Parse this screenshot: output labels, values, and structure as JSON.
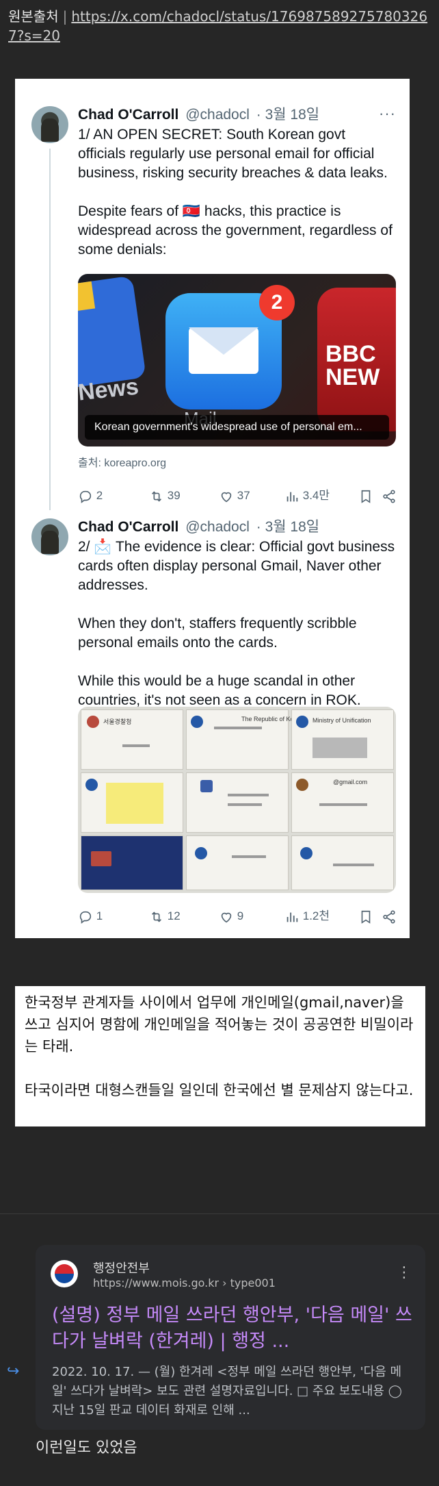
{
  "source": {
    "label": "원본출처",
    "separator": "|",
    "url": "https://x.com/chadocl/status/1769875892757803267?s=20"
  },
  "tweets": [
    {
      "name": "Chad O'Carroll",
      "handle": "@chadocl",
      "date": "· 3월 18일",
      "paragraphs": [
        "1/ AN OPEN SECRET: South Korean govt officials regularly use personal email for official business, risking security breaches & data leaks.",
        "Despite fears of 🇰🇵 hacks, this practice is widespread across the government, regardless of some denials:"
      ],
      "media": {
        "caption": "Korean government's widespread use of personal em...",
        "badge": "2",
        "app_news": "News",
        "app_mail": "Mail",
        "app_bbc": "BBC NEW"
      },
      "source_label": "출처: koreapro.org",
      "stats": {
        "replies": "2",
        "retweets": "39",
        "likes": "37",
        "views": "3.4만"
      }
    },
    {
      "name": "Chad O'Carroll",
      "handle": "@chadocl",
      "date": "· 3월 18일",
      "paragraphs": [
        "2/ 📩 The evidence is clear: Official govt business cards often display personal Gmail, Naver other addresses.",
        "When they don't, staffers frequently scribble personal emails onto the cards.",
        "While this would be a huge scandal in other countries, it's not seen as a concern in ROK."
      ],
      "media": {
        "card_ministry": "Ministry of Unification",
        "card_korea": "The Republic of Korea",
        "card_gmail": "@gmail.com",
        "card_seoul": "서울경찰청"
      },
      "stats": {
        "replies": "1",
        "retweets": "12",
        "likes": "9",
        "views": "1.2천"
      }
    }
  ],
  "korean_note": {
    "p1": "한국정부 관계자들 사이에서 업무에 개인메일(gmail,naver)을 쓰고 심지어 명함에 개인메일을 적어놓는 것이 공공연한 비밀이라는 타래.",
    "p2": "타국이라면 대형스캔들일 일인데 한국에선 별 문제삼지 않는다고."
  },
  "search_result": {
    "site_name": "행정안전부",
    "site_url": "https://www.mois.go.kr › type001",
    "title": "(설명) 정부 메일 쓰라던 행안부, '다음 메일' 쓰다가 날벼락 (한겨레) | 행정 ...",
    "snippet": "2022. 10. 17. — (월) 한겨레 <정부 메일 쓰라던 행안부, '다음 메일' 쓰다가 날벼락> 보도 관련 설명자료입니다. □ 주요 보도내용 ◯ 지난 15일 판교 데이터 화재로 인해 ..."
  },
  "footer": {
    "text": "이런일도 있었음"
  }
}
